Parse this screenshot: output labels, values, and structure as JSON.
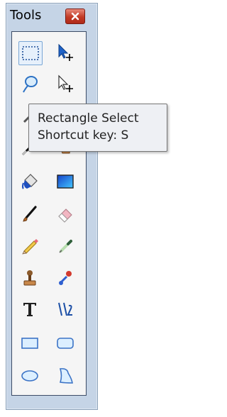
{
  "window": {
    "title": "Tools"
  },
  "tooltip": {
    "line1": "Rectangle Select",
    "line2": "Shortcut key: S"
  },
  "tools": [
    {
      "name": "rectangle-select"
    },
    {
      "name": "move-selected-pixels"
    },
    {
      "name": "lasso-select"
    },
    {
      "name": "move-selection"
    },
    {
      "name": "magic-wand"
    },
    {
      "name": "zoom"
    },
    {
      "name": "pan"
    },
    {
      "name": "hand"
    },
    {
      "name": "paint-bucket"
    },
    {
      "name": "gradient"
    },
    {
      "name": "paintbrush"
    },
    {
      "name": "eraser"
    },
    {
      "name": "pencil"
    },
    {
      "name": "color-picker"
    },
    {
      "name": "clone-stamp"
    },
    {
      "name": "recolor"
    },
    {
      "name": "text"
    },
    {
      "name": "line-curve"
    },
    {
      "name": "rectangle"
    },
    {
      "name": "rounded-rectangle"
    },
    {
      "name": "ellipse"
    },
    {
      "name": "freeform-shape"
    }
  ],
  "colors": {
    "window": "#c5d4e6",
    "panel": "#f5f5f5",
    "close": "#c23a25",
    "accent": "#1f6fd0"
  }
}
